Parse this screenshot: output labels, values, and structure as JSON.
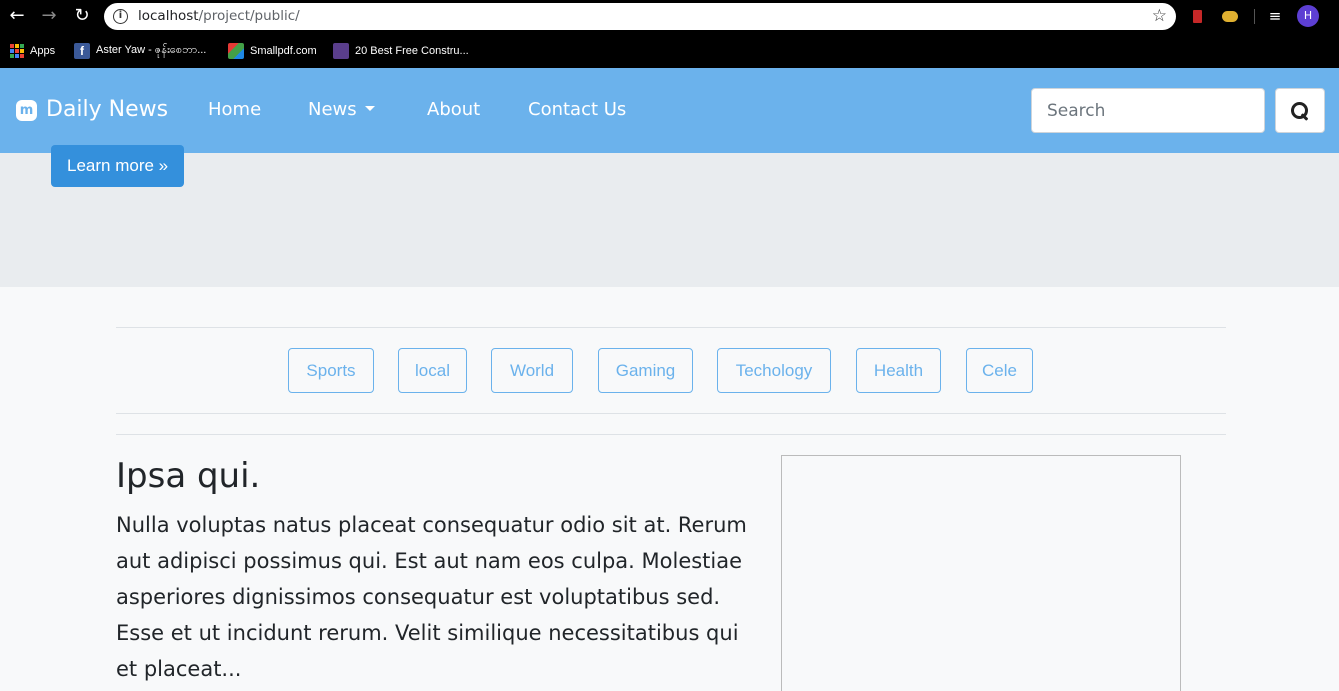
{
  "browser": {
    "url_host": "localhost",
    "url_path": "/project/public/",
    "profile_initial": "H",
    "icons": [
      "back-arrow-icon",
      "forward-arrow-icon",
      "reload-icon",
      "info-icon",
      "star-icon",
      "reading-list-icon"
    ],
    "bookmarks": [
      {
        "label": "Apps",
        "icon": "apps-grid-icon"
      },
      {
        "label": "Aster Yaw - ဇုန်းစေဘာ...",
        "icon": "facebook-icon"
      },
      {
        "label": "Smallpdf.com",
        "icon": "smallpdf-icon"
      },
      {
        "label": "20 Best Free Constru...",
        "icon": "colorlib-icon"
      }
    ]
  },
  "navbar": {
    "brand": "Daily News",
    "links": [
      "Home",
      "News",
      "About",
      "Contact Us"
    ],
    "search_placeholder": "Search",
    "color": "#6bb2ec"
  },
  "jumbotron": {
    "button_label": "Learn more »",
    "button_color": "#3490dc"
  },
  "categories": [
    "Sports",
    "local",
    "World",
    "Gaming",
    "Techology",
    "Health",
    "Cele"
  ],
  "article": {
    "title": "Ipsa qui.",
    "body": "Nulla voluptas natus placeat consequatur odio sit at. Rerum aut adipisci possimus qui. Est aut nam eos culpa. Molestiae asperiores dignissimos consequatur est voluptatibus sed. Esse et ut incidunt rerum. Velit similique necessitatibus qui et placeat..."
  }
}
